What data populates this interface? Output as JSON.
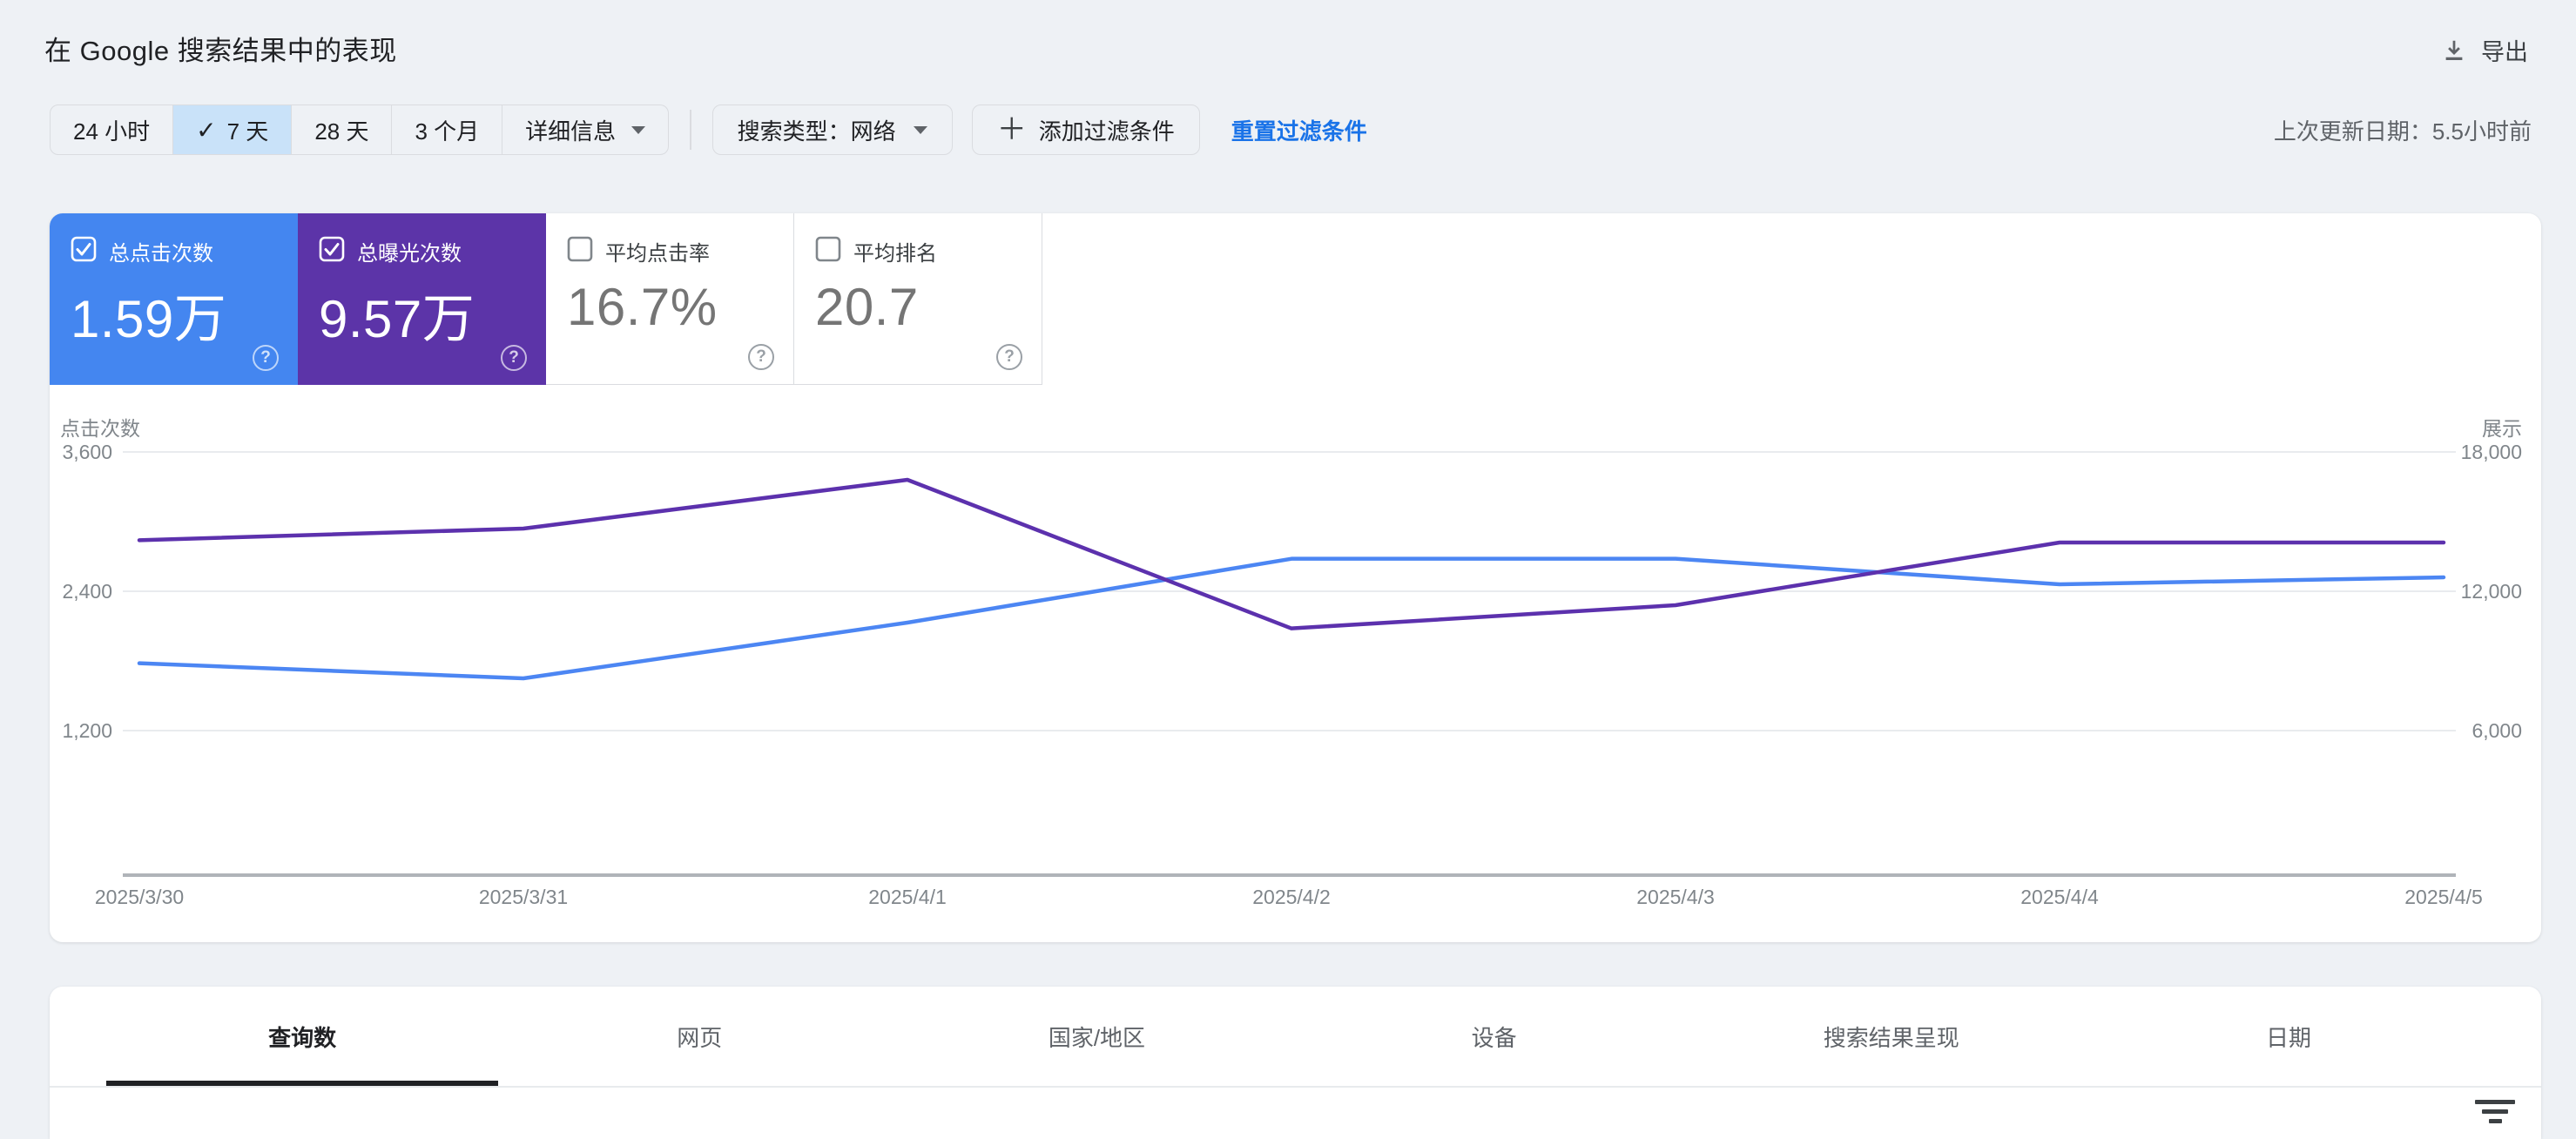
{
  "header": {
    "title": "在 Google 搜索结果中的表现",
    "export_label": "导出"
  },
  "filters": {
    "date_ranges": [
      {
        "label": "24 小时",
        "selected": false
      },
      {
        "label": "7 天",
        "selected": true
      },
      {
        "label": "28 天",
        "selected": false
      },
      {
        "label": "3 个月",
        "selected": false
      },
      {
        "label": "详细信息",
        "selected": false,
        "dropdown": true
      }
    ],
    "search_type_label": "搜索类型：网络",
    "add_filter_label": "添加过滤条件",
    "reset_label": "重置过滤条件",
    "last_updated": "上次更新日期：5.5小时前"
  },
  "metrics": [
    {
      "label": "总点击次数",
      "value": "1.59万",
      "checked": true,
      "color": "#4486f0"
    },
    {
      "label": "总曝光次数",
      "value": "9.57万",
      "checked": true,
      "color": "#5c34a8"
    },
    {
      "label": "平均点击率",
      "value": "16.7%",
      "checked": false,
      "color": "#ffffff"
    },
    {
      "label": "平均排名",
      "value": "20.7",
      "checked": false,
      "color": "#ffffff"
    }
  ],
  "chart_data": {
    "type": "line",
    "x": [
      "2025/3/30",
      "2025/3/31",
      "2025/4/1",
      "2025/4/2",
      "2025/4/3",
      "2025/4/4",
      "2025/4/5"
    ],
    "series": [
      {
        "name": "点击次数",
        "axis": "left",
        "color": "#4c86f3",
        "values": [
          1780,
          1650,
          2130,
          2680,
          2680,
          2460,
          2520
        ]
      },
      {
        "name": "展示",
        "axis": "right",
        "color": "#5c31ad",
        "values": [
          14200,
          14700,
          16800,
          10400,
          11400,
          14100,
          14100
        ]
      }
    ],
    "left_axis": {
      "title": "点击次数",
      "ticks": [
        "3,600",
        "2,400",
        "1,200"
      ],
      "tick_values": [
        3600,
        2400,
        1200
      ],
      "min": 0
    },
    "right_axis": {
      "title": "展示",
      "ticks": [
        "18,000",
        "12,000",
        "6,000"
      ],
      "tick_values": [
        18000,
        12000,
        6000
      ],
      "min": 0
    },
    "grid": "horizontal",
    "legend": "none"
  },
  "tabs": {
    "items": [
      {
        "label": "查询数",
        "selected": true
      },
      {
        "label": "网页",
        "selected": false
      },
      {
        "label": "国家/地区",
        "selected": false
      },
      {
        "label": "设备",
        "selected": false
      },
      {
        "label": "搜索结果呈现",
        "selected": false
      },
      {
        "label": "日期",
        "selected": false
      }
    ]
  }
}
